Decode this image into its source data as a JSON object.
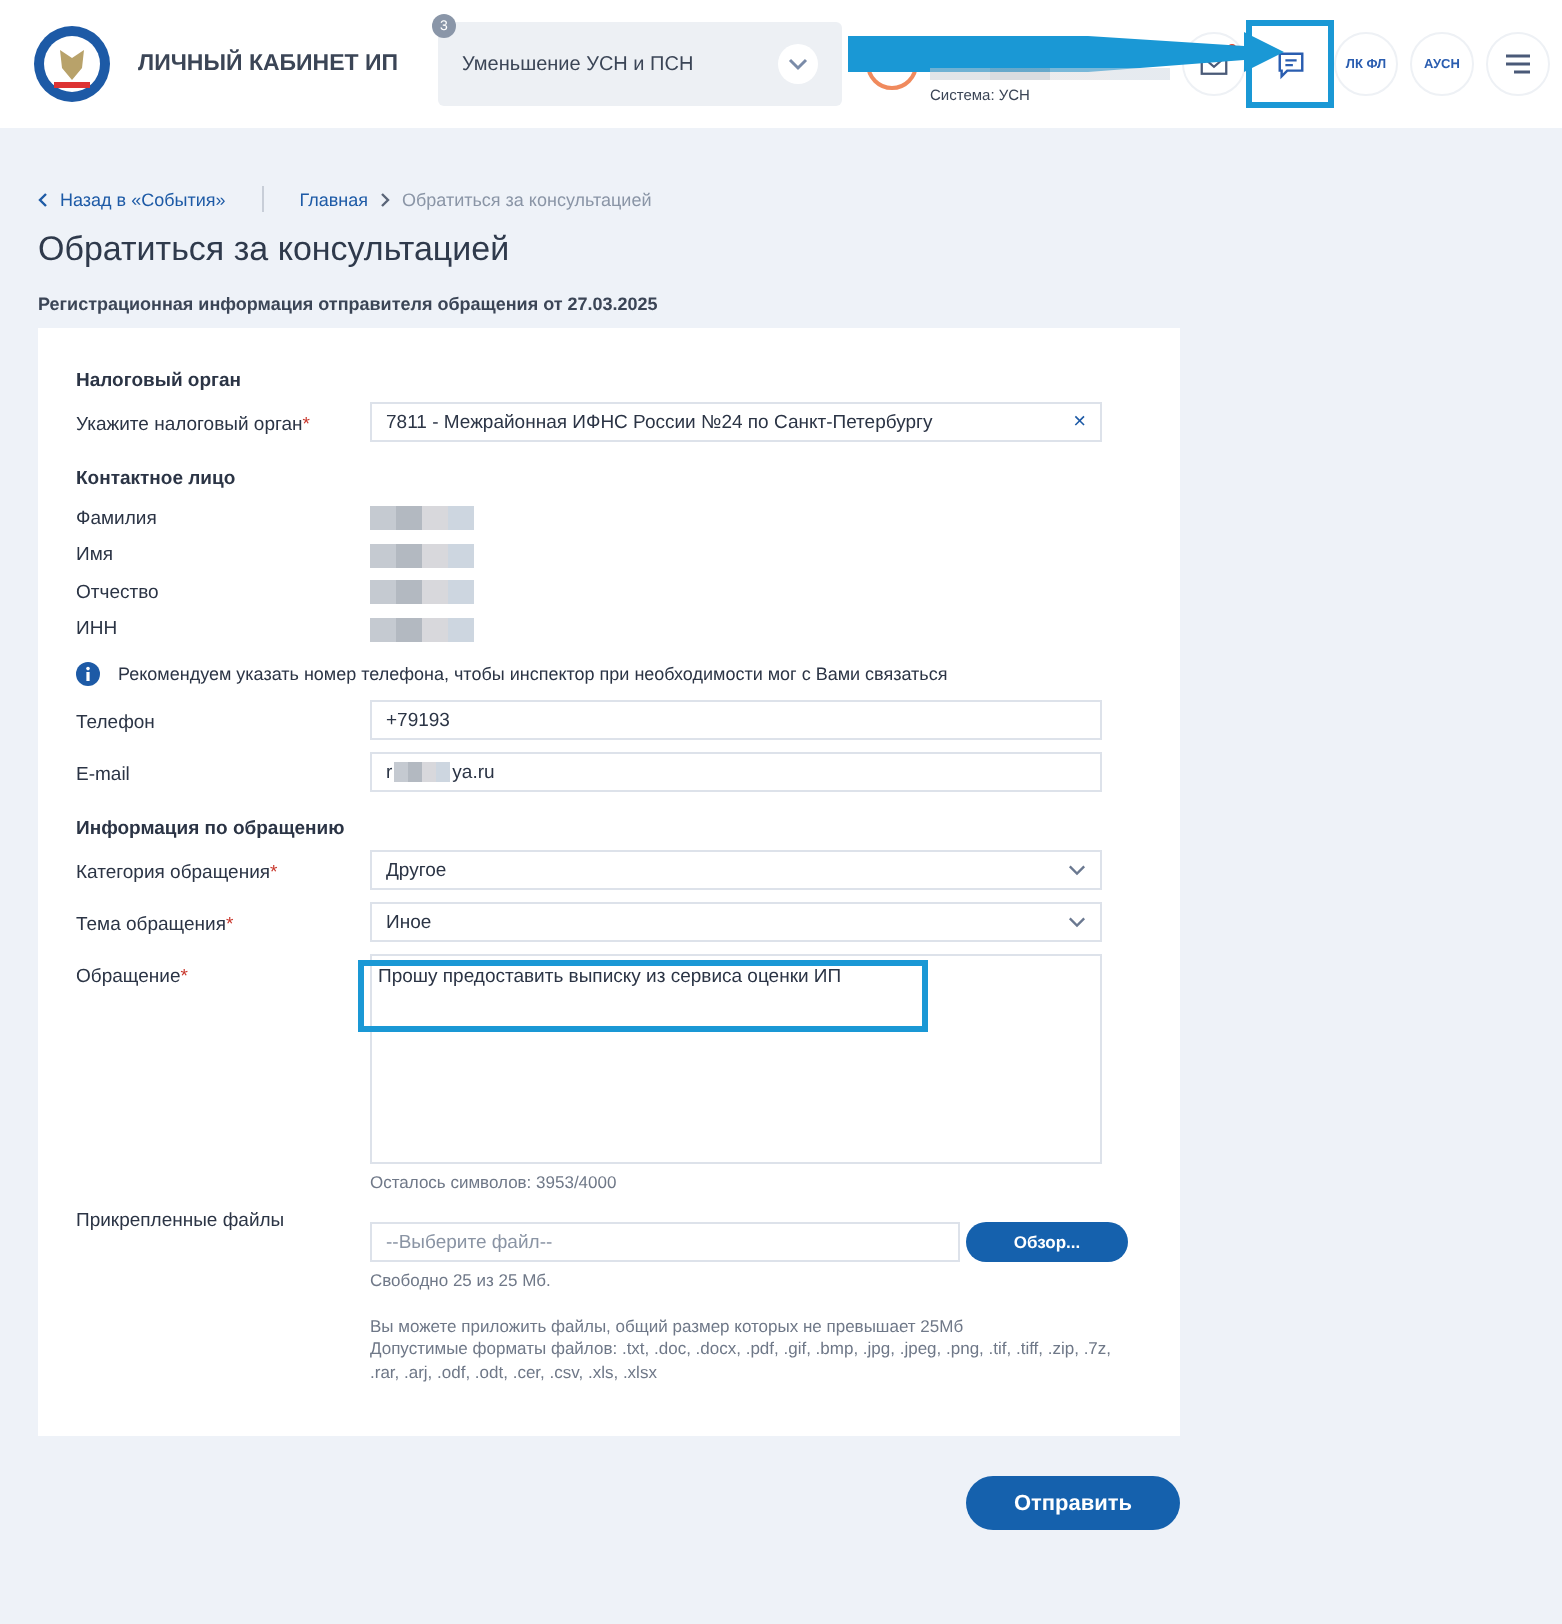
{
  "header": {
    "title": "ЛИЧНЫЙ КАБИНЕТ ИП",
    "service_select": {
      "badge": "3",
      "value": "Уменьшение УСН и ПСН"
    },
    "user": {
      "system": "Система: УСН"
    },
    "icons": [
      {
        "kind": "mail",
        "notification": true,
        "highlighted": false
      },
      {
        "kind": "chat",
        "highlighted": true
      },
      {
        "kind": "text",
        "label": "ЛК ФЛ",
        "highlighted": false
      },
      {
        "kind": "text",
        "label": "АУСН",
        "highlighted": false
      },
      {
        "kind": "menu",
        "highlighted": false
      }
    ]
  },
  "annotation_arrow": true,
  "breadcrumbs": {
    "back": "Назад в «События»",
    "items": [
      {
        "label": "Главная",
        "current": false
      },
      {
        "label": "Обратиться за консультацией",
        "current": true
      }
    ]
  },
  "page_title": "Обратиться за консультацией",
  "subtitle": "Регистрационная информация отправителя обращения от 27.03.2025",
  "rows": [
    {
      "kind": "heading",
      "label": "Налоговый орган"
    },
    {
      "kind": "clearable",
      "label": "Укажите налоговый орган",
      "required_mark": "*",
      "value": "7811 - Межрайонная ИФНС России №24 по Санкт-Петербургу",
      "clear": "×"
    },
    {
      "kind": "heading",
      "label": "Контактное лицо"
    },
    {
      "kind": "redacted",
      "label": "Фамилия"
    },
    {
      "kind": "redacted",
      "label": "Имя"
    },
    {
      "kind": "redacted",
      "label": "Отчество"
    },
    {
      "kind": "redacted",
      "label": "ИНН"
    },
    {
      "kind": "info",
      "text": "Рекомендуем указать номер телефона, чтобы инспектор при необходимости мог с Вами связаться"
    },
    {
      "kind": "input",
      "label": "Телефон",
      "value": "+79193"
    },
    {
      "kind": "input",
      "label": "E-mail",
      "value": "r",
      "value_after_redaction": "ya.ru"
    },
    {
      "kind": "heading",
      "label": "Информация по обращению"
    },
    {
      "kind": "select",
      "label": "Категория обращения",
      "required_mark": "*",
      "value": "Другое"
    },
    {
      "kind": "select",
      "label": "Тема обращения",
      "required_mark": "*",
      "value": "Иное"
    },
    {
      "kind": "textarea",
      "label": "Обращение",
      "required_mark": "*",
      "value": "Прошу предоставить выписку из сервиса оценки ИП",
      "counter": "Осталось символов: 3953/4000",
      "highlighted": true
    },
    {
      "kind": "file",
      "label": "Прикрепленные файлы",
      "placeholder": "--Выберите файл--",
      "button": "Обзор...",
      "free": "Свободно 25 из 25 Мб.",
      "notes": [
        "Вы можете приложить файлы, общий размер которых не превышает 25Мб",
        "Допустимые форматы файлов: .txt, .doc, .docx, .pdf, .gif, .bmp, .jpg, .jpeg, .png, .tif, .tiff, .zip, .7z, .rar, .arj, .odf, .odt, .cer, .csv, .xls, .xlsx"
      ]
    }
  ],
  "submit": "Отправить"
}
